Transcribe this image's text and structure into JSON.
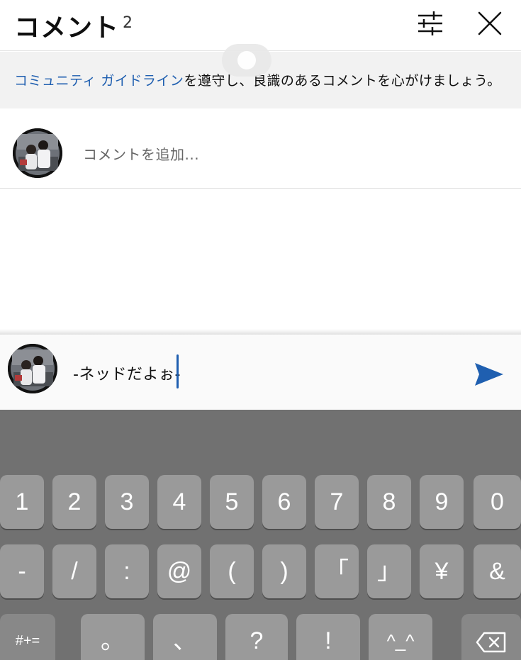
{
  "header": {
    "title": "コメント",
    "count": "2"
  },
  "banner": {
    "link_text": "コミュニティ ガイドライン",
    "rest_text": "を遵守し、良識のあるコメントを心がけましょう。"
  },
  "add_comment": {
    "placeholder": "コメントを追加..."
  },
  "compose": {
    "text": "-ネッドだよぉ-"
  },
  "keyboard": {
    "row1": [
      "1",
      "2",
      "3",
      "4",
      "5",
      "6",
      "7",
      "8",
      "9",
      "0"
    ],
    "row2": [
      "-",
      "/",
      ":",
      "@",
      "(",
      ")",
      "「",
      "」",
      "¥",
      "&"
    ],
    "row3": [
      "#+=",
      "。",
      "、",
      "?",
      "!",
      "^_^"
    ]
  },
  "icons": {
    "filter": "sliders-icon",
    "close": "close-icon",
    "send": "send-icon",
    "backspace": "backspace-icon"
  },
  "colors": {
    "accent": "#1f5fb0",
    "keyboard_bg": "#717171",
    "key_bg": "#9a9a9a"
  }
}
